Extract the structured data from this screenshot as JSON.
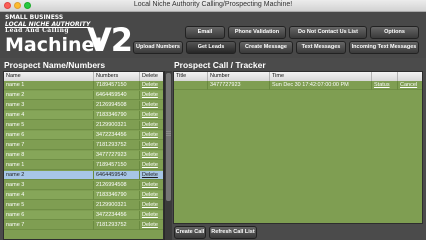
{
  "window": {
    "title": "Local Niche Authority Calling/Prospecting Machine!"
  },
  "logo": {
    "line1": "SMALL BUSINESS",
    "line2": "LOCAL NICHE AUTHORITY",
    "line3": "Lead And Calling",
    "line4": "Machine!",
    "version": "V2"
  },
  "toolbar": {
    "email": "Email",
    "phone_validation": "Phone Validation",
    "do_not_contact": "Do Not Contact Us List",
    "options": "Options",
    "upload_numbers": "Upload Numbers",
    "get_leads": "Get Leads",
    "create_message": "Create Message",
    "text_messages": "Text Messages",
    "incoming_text_messages": "Incoming Text Messages"
  },
  "prospects": {
    "title": "Prospect Name/Numbers",
    "columns": [
      "Name",
      "Numbers",
      "Delete"
    ],
    "rows": [
      {
        "name": "name 1",
        "number": "7189457150",
        "action": "Delete"
      },
      {
        "name": "name 2",
        "number": "6464459540",
        "action": "Delete"
      },
      {
        "name": "name 3",
        "number": "2126994508",
        "action": "Delete"
      },
      {
        "name": "name 4",
        "number": "7183346790",
        "action": "Delete"
      },
      {
        "name": "name 5",
        "number": "2129900321",
        "action": "Delete"
      },
      {
        "name": "name 6",
        "number": "3472234456",
        "action": "Delete"
      },
      {
        "name": "name 7",
        "number": "7181293752",
        "action": "Delete"
      },
      {
        "name": "name 8",
        "number": "3477727923",
        "action": "Delete"
      },
      {
        "name": "name 1",
        "number": "7189457150",
        "action": "Delete"
      },
      {
        "name": "name 2",
        "number": "6464459540",
        "action": "Delete"
      },
      {
        "name": "name 3",
        "number": "2126994508",
        "action": "Delete"
      },
      {
        "name": "name 4",
        "number": "7183346790",
        "action": "Delete"
      },
      {
        "name": "name 5",
        "number": "2129900321",
        "action": "Delete"
      },
      {
        "name": "name 6",
        "number": "3472234456",
        "action": "Delete"
      },
      {
        "name": "name 7",
        "number": "7181293752",
        "action": "Delete"
      }
    ]
  },
  "tracker": {
    "title": "Prospect Call / Tracker",
    "columns": [
      "Title",
      "Number",
      "Time",
      "",
      ""
    ],
    "rows": [
      {
        "title": "",
        "number": "3477727923",
        "time": "Sun Dec 30 17:42:07:00:00 PM",
        "status": "Status",
        "cancel": "Cancel"
      }
    ],
    "create_call": "Create Call",
    "refresh_call_list": "Refresh Call List"
  },
  "colors": {
    "grid_green": "#7f9e52",
    "selected_row": "#a7c6e6",
    "header_bg": "#484848"
  }
}
